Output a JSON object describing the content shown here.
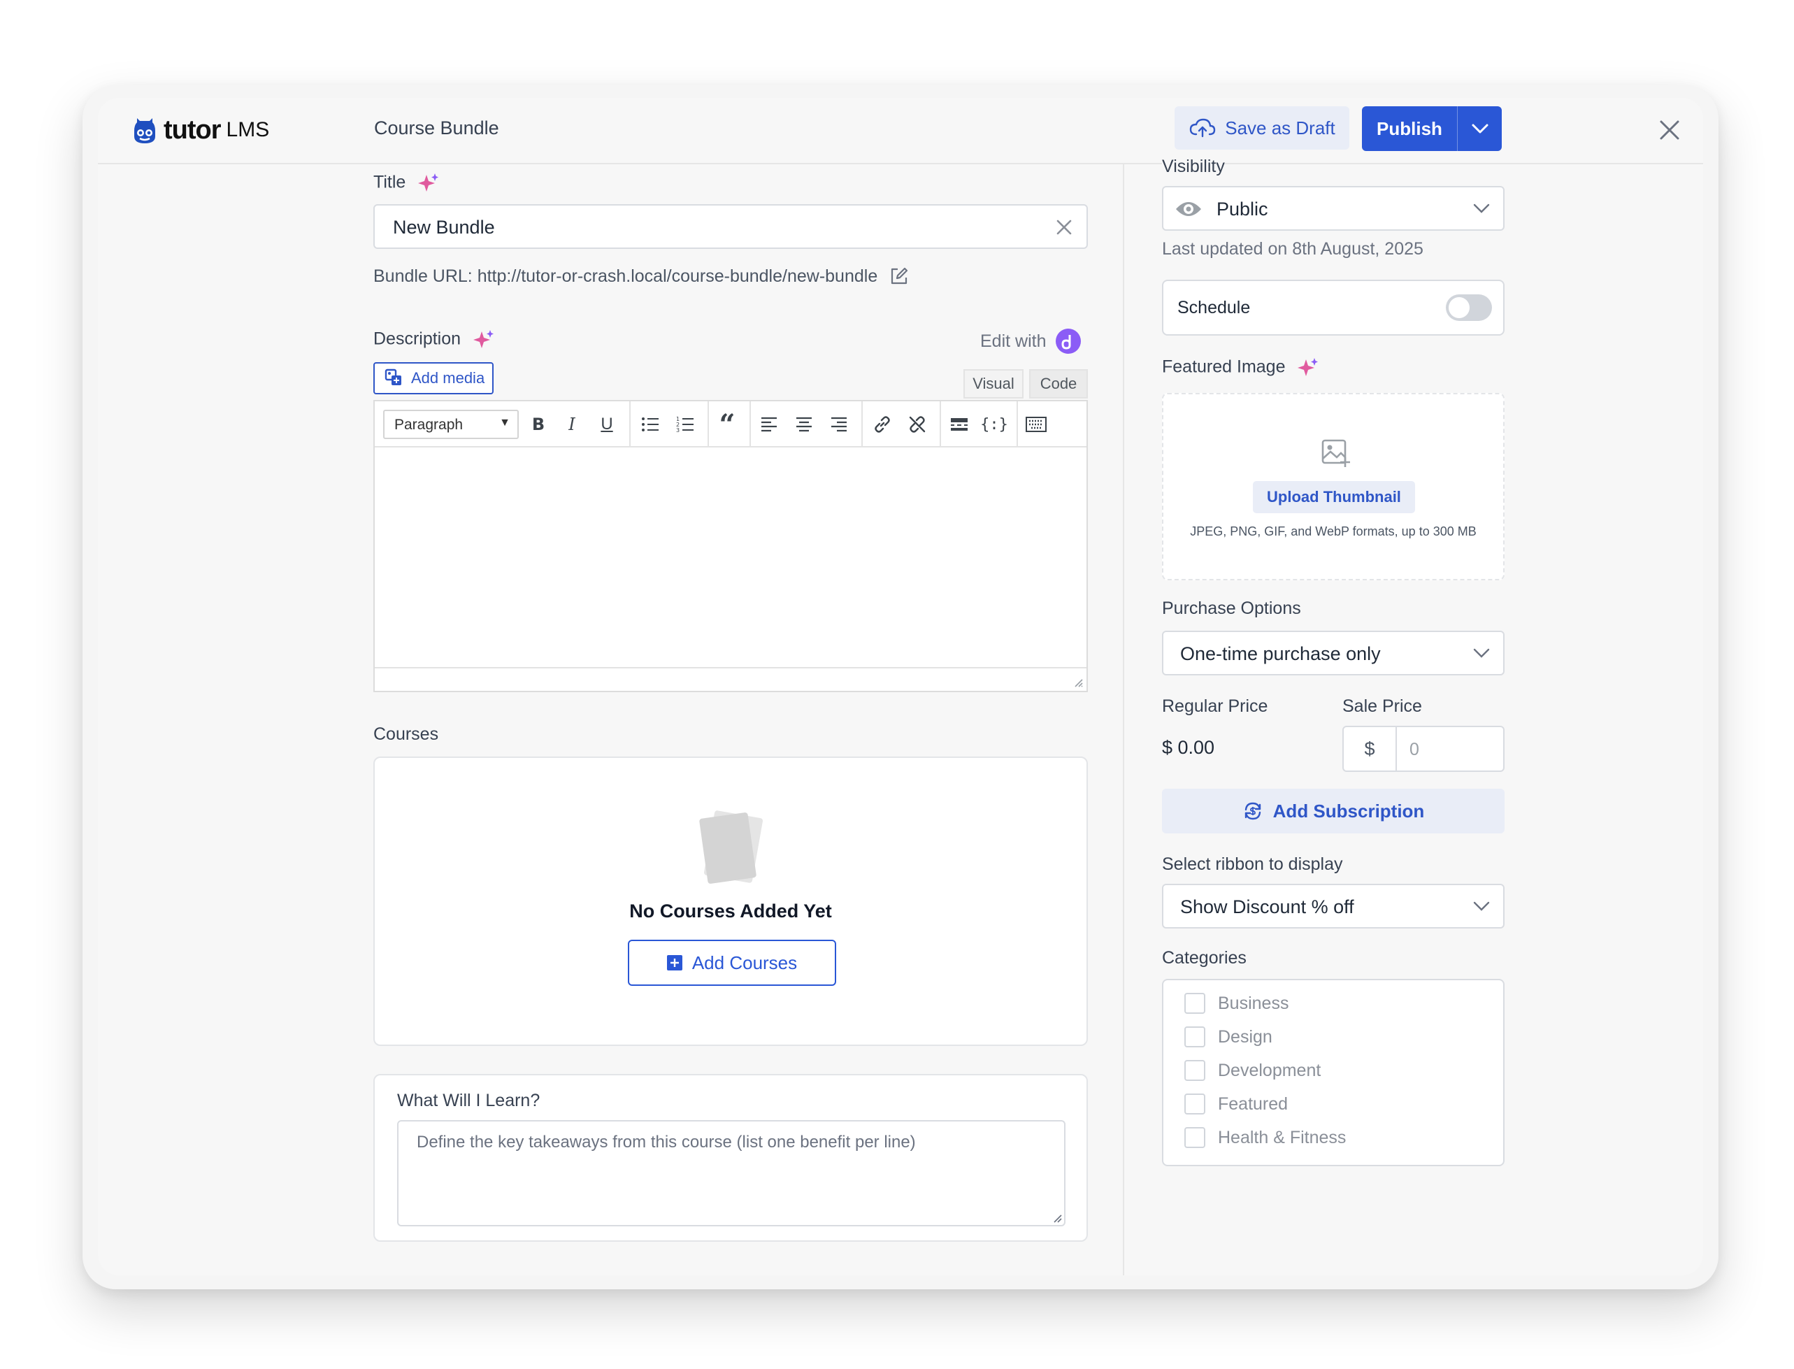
{
  "brand": {
    "name": "tutor",
    "suffix": "LMS"
  },
  "header": {
    "title": "Course Bundle",
    "save_draft": "Save as Draft",
    "publish": "Publish"
  },
  "title_field": {
    "label": "Title",
    "value": "New Bundle"
  },
  "bundle_url": {
    "prefix": "Bundle URL: ",
    "url": "http://tutor-or-crash.local/course-bundle/new-bundle"
  },
  "description": {
    "label": "Description",
    "edit_with": "Edit with",
    "add_media": "Add media",
    "tab_visual": "Visual",
    "tab_code": "Code",
    "paragraph": "Paragraph"
  },
  "courses": {
    "label": "Courses",
    "empty_text": "No Courses Added Yet",
    "add_button": "Add Courses"
  },
  "learn": {
    "label": "What Will I Learn?",
    "placeholder": "Define the key takeaways from this course (list one benefit per line)"
  },
  "sidebar": {
    "visibility_label": "Visibility",
    "visibility_value": "Public",
    "last_updated": "Last updated on 8th August, 2025",
    "schedule": "Schedule",
    "featured_image": "Featured Image",
    "upload_thumbnail": "Upload Thumbnail",
    "upload_hint": "JPEG, PNG, GIF, and WebP formats, up to 300 MB",
    "purchase_label": "Purchase Options",
    "purchase_value": "One-time purchase only",
    "regular_price_label": "Regular Price",
    "regular_price_value": "$ 0.00",
    "sale_price_label": "Sale Price",
    "currency": "$",
    "sale_placeholder": "0",
    "add_subscription": "Add Subscription",
    "ribbon_label": "Select ribbon to display",
    "ribbon_value": "Show Discount % off",
    "categories_label": "Categories",
    "categories": [
      "Business",
      "Design",
      "Development",
      "Featured",
      "Health & Fitness"
    ]
  },
  "colors": {
    "accent": "#2a57d6",
    "accent_light": "#e9edf7",
    "panel": "#f7f7f7"
  }
}
